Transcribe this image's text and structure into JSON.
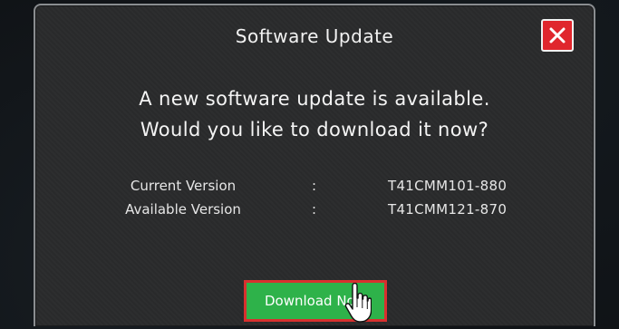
{
  "dialog": {
    "title": "Software Update",
    "message_line1": "A new software update is available.",
    "message_line2": "Would you like to download it now?",
    "versions": [
      {
        "label": "Current Version",
        "separator": ":",
        "value": "T41CMM101-880"
      },
      {
        "label": "Available Version",
        "separator": ":",
        "value": "T41CMM121-870"
      }
    ],
    "download_label": "Download Now",
    "close_icon": "close-icon",
    "colors": {
      "close_bg": "#e0262d",
      "download_bg": "#2eb24a",
      "download_border": "#d8302f"
    }
  }
}
